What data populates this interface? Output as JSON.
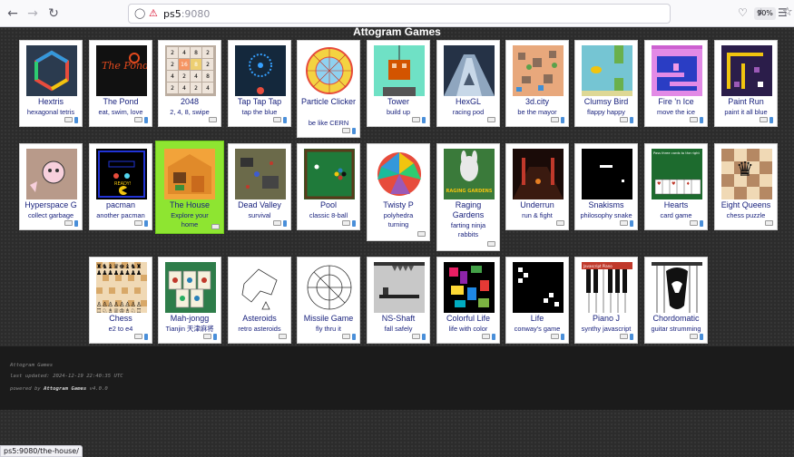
{
  "browser": {
    "url_host": "ps5",
    "url_port": ":9080",
    "zoom": "90%",
    "status_url": "ps5:9080/the-house/"
  },
  "site": {
    "title": "Attogram Games"
  },
  "games": [
    {
      "name": "Hextris",
      "sub": "hexagonal tetris"
    },
    {
      "name": "The Pond",
      "sub": "eat, swim, love"
    },
    {
      "name": "2048",
      "sub": "2, 4, 8, swipe"
    },
    {
      "name": "Tap Tap Tap",
      "sub": "tap the blue"
    },
    {
      "name": "Particle Clicker",
      "sub": "be like CERN"
    },
    {
      "name": "Tower",
      "sub": "build up"
    },
    {
      "name": "HexGL",
      "sub": "racing pod"
    },
    {
      "name": "3d.city",
      "sub": "be the mayor"
    },
    {
      "name": "Clumsy Bird",
      "sub": "flappy happy"
    },
    {
      "name": "Fire 'n Ice",
      "sub": "move the ice"
    },
    {
      "name": "Paint Run",
      "sub": "paint it all blue"
    },
    {
      "name": "Hyperspace G",
      "sub": "collect garbage"
    },
    {
      "name": "pacman",
      "sub": "another pacman"
    },
    {
      "name": "The House",
      "sub": "Explore your home"
    },
    {
      "name": "Dead Valley",
      "sub": "survival"
    },
    {
      "name": "Pool",
      "sub": "classic 8-ball"
    },
    {
      "name": "Twisty P",
      "sub": "polyhedra turning"
    },
    {
      "name": "Raging Gardens",
      "sub": "farting ninja rabbits"
    },
    {
      "name": "Underrun",
      "sub": "run & fight"
    },
    {
      "name": "Snakisms",
      "sub": "philosophy snake"
    },
    {
      "name": "Hearts",
      "sub": "card game"
    },
    {
      "name": "Eight Queens",
      "sub": "chess puzzle"
    },
    {
      "name": "Chess",
      "sub": "e2 to e4"
    },
    {
      "name": "Mah-jongg",
      "sub": "Tianjin 天津麻将"
    },
    {
      "name": "Asteroids",
      "sub": "retro asteroids"
    },
    {
      "name": "Missile Game",
      "sub": "fly thru it"
    },
    {
      "name": "NS-Shaft",
      "sub": "fall safely"
    },
    {
      "name": "Colorful Life",
      "sub": "life with color"
    },
    {
      "name": "Life",
      "sub": "conway's game"
    },
    {
      "name": "Piano J",
      "sub": "synthy javascript"
    },
    {
      "name": "Chordomatic",
      "sub": "guitar strumming"
    }
  ],
  "thumb_texts": {
    "pond_logo": "The Pond",
    "hearts_caption": "Pass three cards to the right",
    "pacman_ready": "READY!",
    "raging_logo": "RAGING GARDENS",
    "piano_title": "Javascript Piano"
  },
  "footer": {
    "brand": "Attogram Games",
    "updated": "last updated: 2024-12-19 22:40:35 UTC",
    "powered_prefix": "powered by ",
    "powered_name": "Attogram Games",
    "powered_version": " v4.0.0"
  },
  "colors": {
    "selected": "#8ee531",
    "link": "#1a237e"
  }
}
